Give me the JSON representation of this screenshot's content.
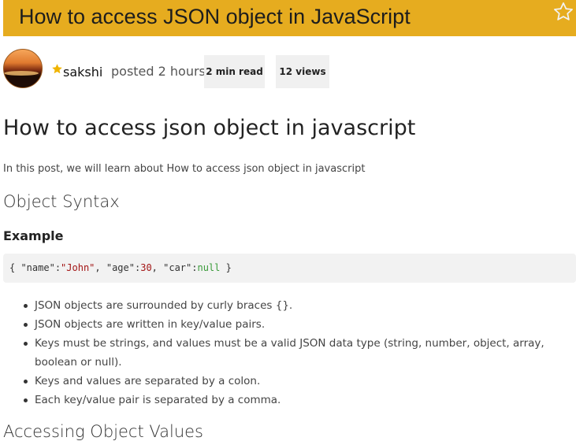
{
  "header": {
    "title": "How to access JSON object in JavaScript",
    "bookmark_icon": "star-outline-icon",
    "bar_color": "#e6ac1f"
  },
  "meta": {
    "author": "sakshi",
    "author_badge_icon": "star-filled-icon",
    "posted": "posted 2 hours",
    "read_time": "2 min read",
    "views": "12 views"
  },
  "article": {
    "heading": "How to access json object in javascript",
    "intro": "In this post, we will learn about How to access json object in javascript",
    "section_heading": "Object Syntax",
    "example_label": "Example",
    "code": {
      "open": "{ ",
      "k1": "\"name\"",
      "c1": ":",
      "v1": "\"John\"",
      "s1": ", ",
      "k2": "\"age\"",
      "c2": ":",
      "v2": "30",
      "s2": ", ",
      "k3": "\"car\"",
      "c3": ":",
      "v3": "null",
      "close": " }"
    },
    "points": [
      "JSON objects are surrounded by curly braces {}.",
      "JSON objects are written in key/value pairs.",
      "Keys must be strings, and values must be a valid JSON data type (string, number, object, array, boolean or null).",
      "Keys and values are separated by a colon.",
      "Each key/value pair is separated by a comma."
    ],
    "next_heading": "Accessing Object Values"
  }
}
